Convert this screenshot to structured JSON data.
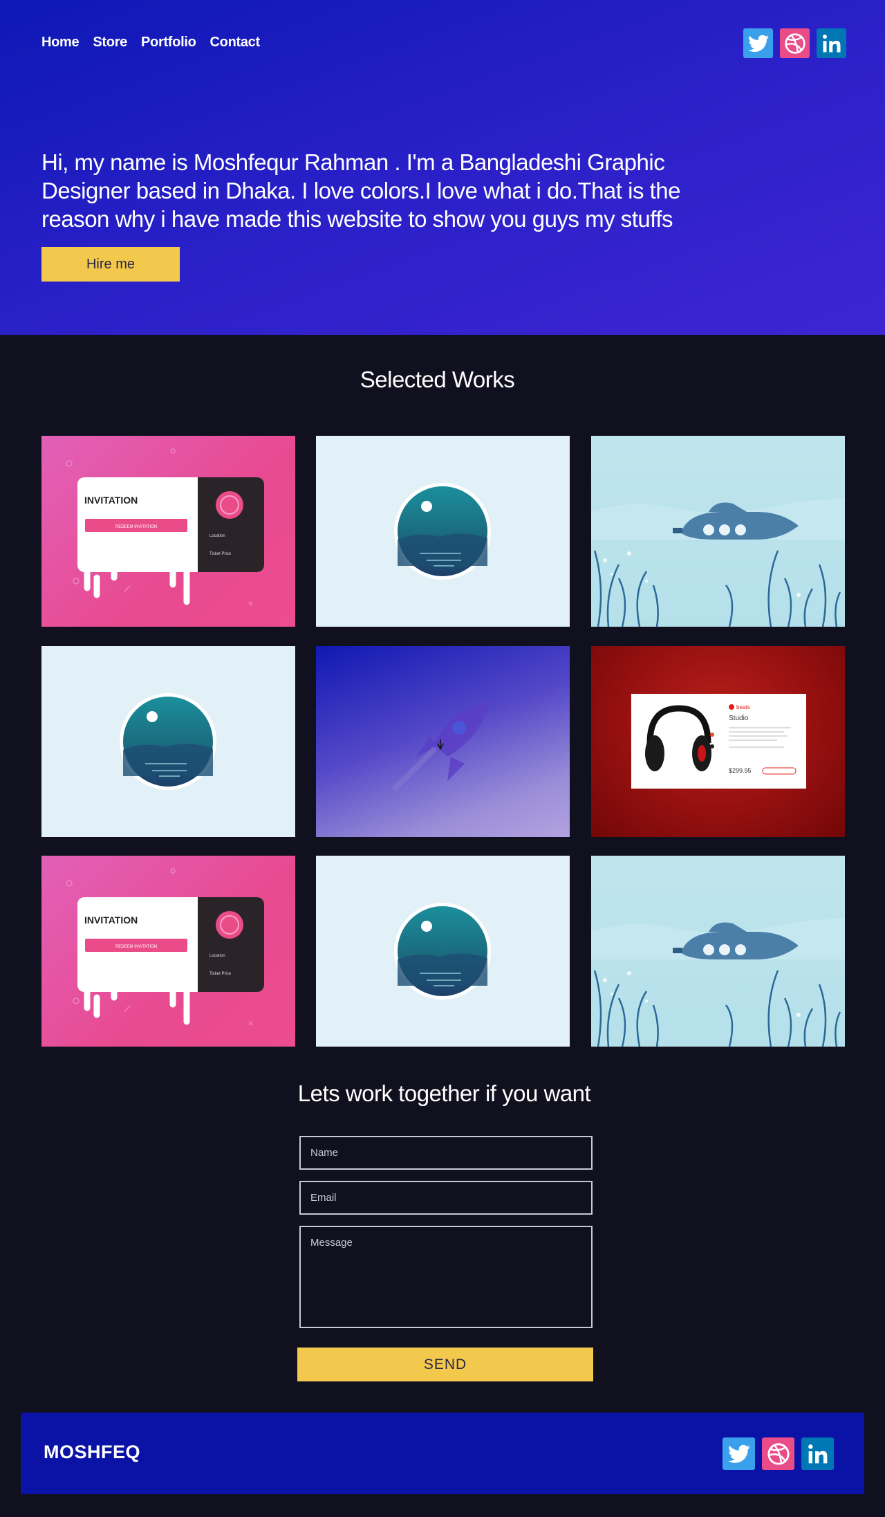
{
  "nav": {
    "items": [
      {
        "label": "Home"
      },
      {
        "label": "Store"
      },
      {
        "label": "Portfolio"
      },
      {
        "label": "Contact"
      }
    ]
  },
  "social": {
    "icons": [
      "twitter-icon",
      "dribbble-icon",
      "linkedin-icon"
    ]
  },
  "hero": {
    "intro": "Hi, my name is Moshfequr Rahman . I'm a Bangladeshi Graphic Designer based in Dhaka. I love colors.I love what i do.That is the reason why i have made this website to show you guys my stuffs",
    "cta_label": "Hire me"
  },
  "works": {
    "title": "Selected Works",
    "tiles": [
      {
        "kind": "invitation-card"
      },
      {
        "kind": "moon-circle"
      },
      {
        "kind": "submarine"
      },
      {
        "kind": "moon-circle"
      },
      {
        "kind": "rocket"
      },
      {
        "kind": "headphones"
      },
      {
        "kind": "invitation-card"
      },
      {
        "kind": "moon-circle"
      },
      {
        "kind": "submarine"
      }
    ],
    "invitation": {
      "title": "INVITATION",
      "button": "REDEEM INVITATION",
      "location": "Location",
      "ticket": "Ticket Price"
    },
    "product": {
      "brand": "beats",
      "name": "Studio",
      "price": "$299.95"
    }
  },
  "contact": {
    "title": "Lets work together if you want",
    "name_placeholder": "Name",
    "email_placeholder": "Email",
    "message_placeholder": "Message",
    "send_label": "SEND"
  },
  "footer": {
    "brand": "MOSHFEQ"
  },
  "colors": {
    "hero_start": "#0d18b5",
    "hero_end": "#3d25d3",
    "accent_yellow": "#f2c94c",
    "page_bg": "#11101f",
    "footer_bg": "#0a13a6",
    "twitter": "#3aa0ec",
    "dribbble": "#ea4c89",
    "linkedin": "#0077b5"
  }
}
